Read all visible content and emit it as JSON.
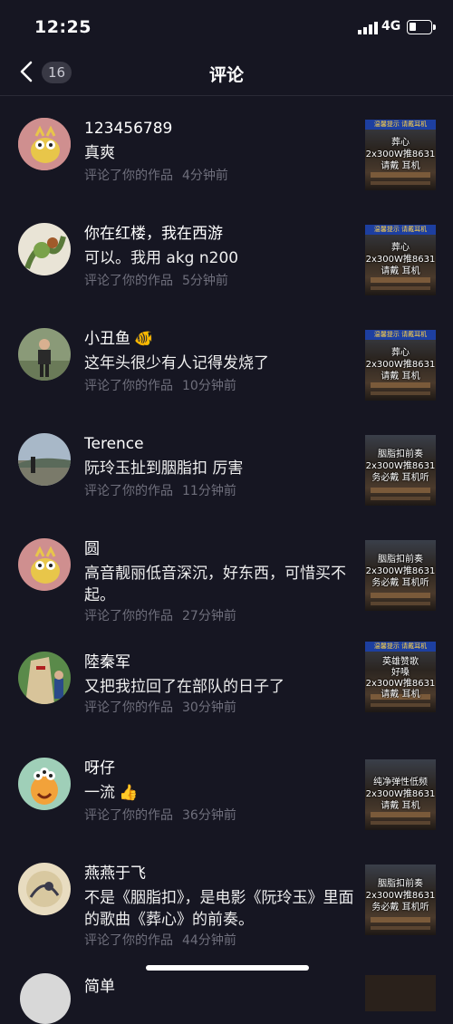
{
  "status_bar": {
    "time": "12:25",
    "network": "4G"
  },
  "nav": {
    "title": "评论",
    "badge_count": "16"
  },
  "comments": [
    {
      "username": "123456789",
      "text": "真爽",
      "action": "评论了你的作品",
      "time": "4分钟前",
      "thumb_lines": [
        "葬心",
        "2x300W推8631",
        "请戴  耳机"
      ],
      "thumb_banner": "温馨提示 请戴耳机"
    },
    {
      "username": "你在红楼，我在西游",
      "text": "可以。我用 akg n200",
      "action": "评论了你的作品",
      "time": "5分钟前",
      "thumb_lines": [
        "葬心",
        "2x300W推8631",
        "请戴  耳机"
      ],
      "thumb_banner": "温馨提示 请戴耳机"
    },
    {
      "username": "小丑鱼",
      "text": "这年头很少有人记得发烧了",
      "action": "评论了你的作品",
      "time": "10分钟前",
      "thumb_lines": [
        "葬心",
        "2x300W推8631",
        "请戴  耳机"
      ],
      "thumb_banner": "温馨提示 请戴耳机"
    },
    {
      "username": "Terence",
      "text": "阮玲玉扯到胭脂扣 厉害",
      "action": "评论了你的作品",
      "time": "11分钟前",
      "thumb_lines": [
        "胭脂扣前奏",
        "2x300W推8631",
        "务必戴  耳机听"
      ]
    },
    {
      "username": "圆",
      "text": "高音靓丽低音深沉，好东西，可惜买不起。",
      "action": "评论了你的作品",
      "time": "27分钟前",
      "thumb_lines": [
        "胭脂扣前奏",
        "2x300W推8631",
        "务必戴  耳机听"
      ]
    },
    {
      "username": "陸秦军",
      "text": "又把我拉回了在部队的日子了",
      "action": "评论了你的作品",
      "time": "30分钟前",
      "thumb_lines": [
        "英雄赞歌",
        "好嗓",
        "2x300W推8631",
        "请戴  耳机"
      ],
      "thumb_banner": "温馨提示 请戴耳机"
    },
    {
      "username": "呀仔",
      "text": "一流",
      "action": "评论了你的作品",
      "time": "36分钟前",
      "thumb_lines": [
        "纯净弹性低频",
        "2x300W推8631",
        "请戴  耳机"
      ]
    },
    {
      "username": "燕燕于飞",
      "text": "不是《胭脂扣》，是电影《阮玲玉》里面的歌曲《葬心》的前奏。",
      "action": "评论了你的作品",
      "time": "44分钟前",
      "thumb_lines": [
        "胭脂扣前奏",
        "2x300W推8631",
        "务必戴  耳机听"
      ]
    }
  ],
  "partial": {
    "username": "简单"
  },
  "colors": {
    "background": "#161622",
    "meta": "#6f6f7c",
    "badge_bg": "#393945"
  }
}
